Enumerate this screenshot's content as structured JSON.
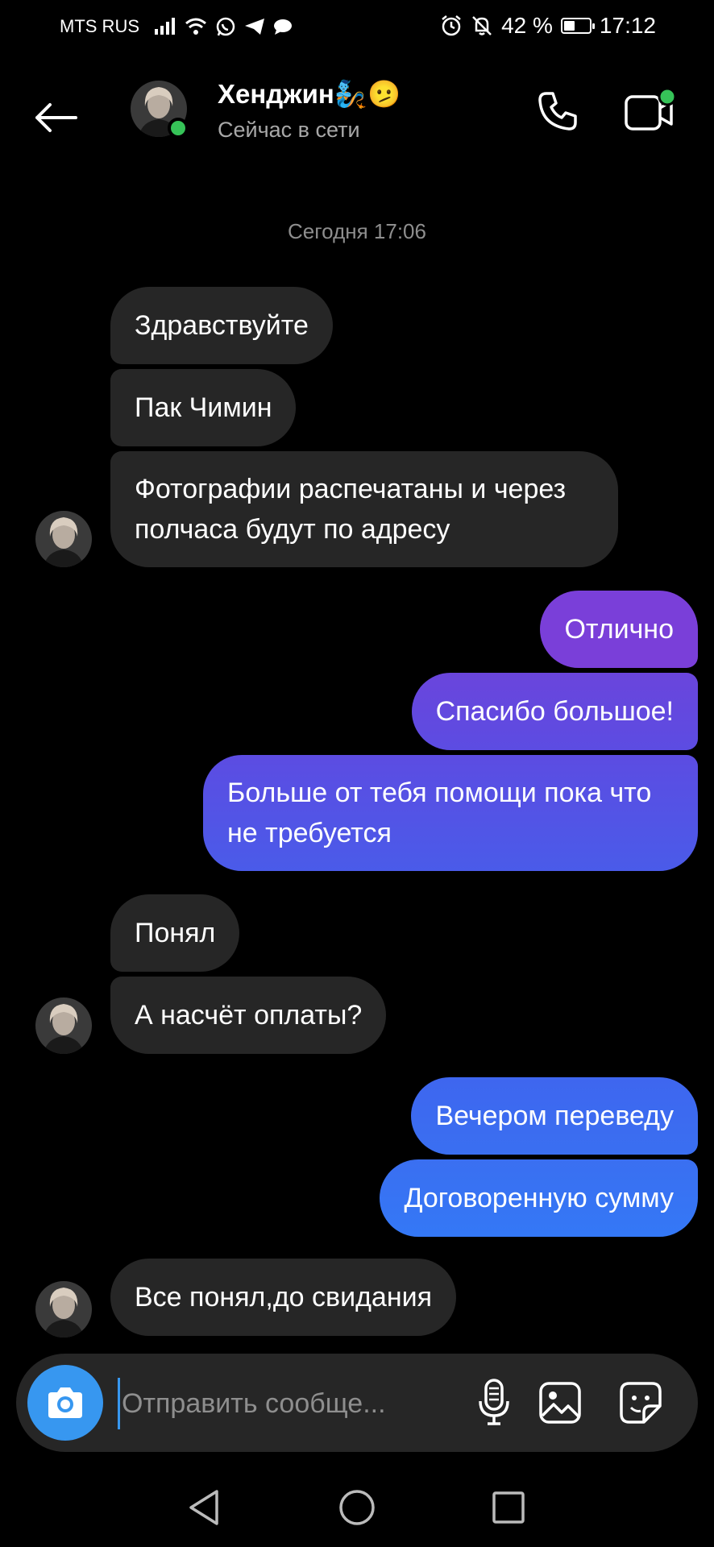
{
  "status_bar": {
    "carrier": "MTS RUS",
    "battery_percent": "42 %",
    "battery_level": 0.42,
    "time": "17:12",
    "icons": [
      "signal-icon",
      "wifi-icon",
      "whatsapp-icon",
      "telegram-icon",
      "chat-icon",
      "alarm-icon",
      "mute-icon",
      "battery-icon"
    ]
  },
  "header": {
    "contact_name": "Хенджин🧞🫤",
    "contact_status": "Сейчас в сети",
    "icons": [
      "back-arrow-icon",
      "phone-icon",
      "video-camera-icon"
    ]
  },
  "conversation": {
    "timestamp": "Сегодня 17:06",
    "messages": [
      {
        "side": "in",
        "text": "Здравствуйте"
      },
      {
        "side": "in",
        "text": "Пак Чимин"
      },
      {
        "side": "in",
        "text": "Фотографии распечатаны и через полчаса будут по адресу"
      },
      {
        "side": "out",
        "text": "Отлично"
      },
      {
        "side": "out",
        "text": "Спасибо большое!"
      },
      {
        "side": "out",
        "text": "Больше от тебя помощи пока что не требуется"
      },
      {
        "side": "in",
        "text": "Понял"
      },
      {
        "side": "in",
        "text": "А насчёт оплаты?"
      },
      {
        "side": "out",
        "text": "Вечером переведу"
      },
      {
        "side": "out",
        "text": "Договоренную сумму"
      },
      {
        "side": "in",
        "text": "Все понял,до свидания"
      }
    ]
  },
  "composer": {
    "placeholder": "Отправить сообще...",
    "value": "",
    "icons": [
      "camera-icon",
      "microphone-icon",
      "gallery-icon",
      "sticker-icon"
    ]
  },
  "colors": {
    "background": "#000000",
    "incoming_bubble": "#262626",
    "outgoing_gradient_top": "#7c3fd8",
    "outgoing_gradient_bottom": "#3478f6",
    "online": "#36c358",
    "accent": "#3797f0"
  }
}
